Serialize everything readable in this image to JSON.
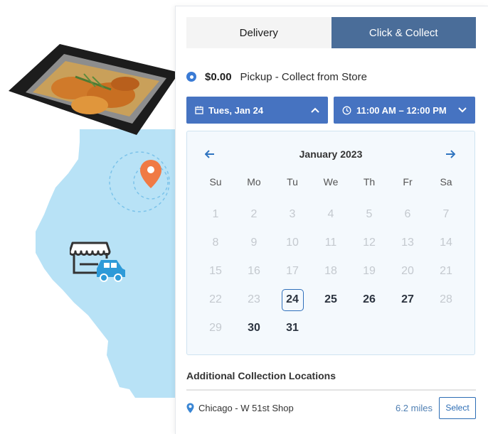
{
  "illustration": {
    "tray_icon": "food-tray",
    "pin_icon": "map-pin-icon",
    "store_icon": "store-icon",
    "car_icon": "car-icon",
    "colors": {
      "map": "#b8e2f6",
      "pin": "#f07a45",
      "icon": "#2d9ad8"
    }
  },
  "tabs": [
    {
      "label": "Delivery",
      "active": false
    },
    {
      "label": "Click & Collect",
      "active": true
    }
  ],
  "pickup_option": {
    "price": "$0.00",
    "label": "Pickup - Collect from Store",
    "selected": true
  },
  "date_dropdown": {
    "value": "Tues, Jan 24",
    "icon": "calendar-icon",
    "chevron": "chevron-up-icon"
  },
  "time_dropdown": {
    "value": "11:00 AM – 12:00 PM",
    "icon": "clock-icon",
    "chevron": "chevron-down-icon"
  },
  "calendar": {
    "month": "January 2023",
    "weekdays": [
      "Su",
      "Mo",
      "Tu",
      "We",
      "Th",
      "Fr",
      "Sa"
    ],
    "days": [
      {
        "n": "1",
        "s": "disabled"
      },
      {
        "n": "2",
        "s": "disabled"
      },
      {
        "n": "3",
        "s": "disabled"
      },
      {
        "n": "4",
        "s": "disabled"
      },
      {
        "n": "5",
        "s": "disabled"
      },
      {
        "n": "6",
        "s": "disabled"
      },
      {
        "n": "7",
        "s": "disabled"
      },
      {
        "n": "8",
        "s": "disabled"
      },
      {
        "n": "9",
        "s": "disabled"
      },
      {
        "n": "10",
        "s": "disabled"
      },
      {
        "n": "11",
        "s": "disabled"
      },
      {
        "n": "12",
        "s": "disabled"
      },
      {
        "n": "13",
        "s": "disabled"
      },
      {
        "n": "14",
        "s": "disabled"
      },
      {
        "n": "15",
        "s": "disabled"
      },
      {
        "n": "16",
        "s": "disabled"
      },
      {
        "n": "17",
        "s": "disabled"
      },
      {
        "n": "18",
        "s": "disabled"
      },
      {
        "n": "19",
        "s": "disabled"
      },
      {
        "n": "20",
        "s": "disabled"
      },
      {
        "n": "21",
        "s": "disabled"
      },
      {
        "n": "22",
        "s": "disabled"
      },
      {
        "n": "23",
        "s": "disabled"
      },
      {
        "n": "24",
        "s": "selected"
      },
      {
        "n": "25",
        "s": "available"
      },
      {
        "n": "26",
        "s": "available"
      },
      {
        "n": "27",
        "s": "available"
      },
      {
        "n": "28",
        "s": "disabled"
      },
      {
        "n": "29",
        "s": "disabled"
      },
      {
        "n": "30",
        "s": "available"
      },
      {
        "n": "31",
        "s": "available"
      }
    ]
  },
  "additional_locations": {
    "title": "Additional Collection Locations",
    "items": [
      {
        "name": "Chicago -  W 51st Shop",
        "distance": "6.2 miles",
        "button": "Select"
      }
    ]
  }
}
